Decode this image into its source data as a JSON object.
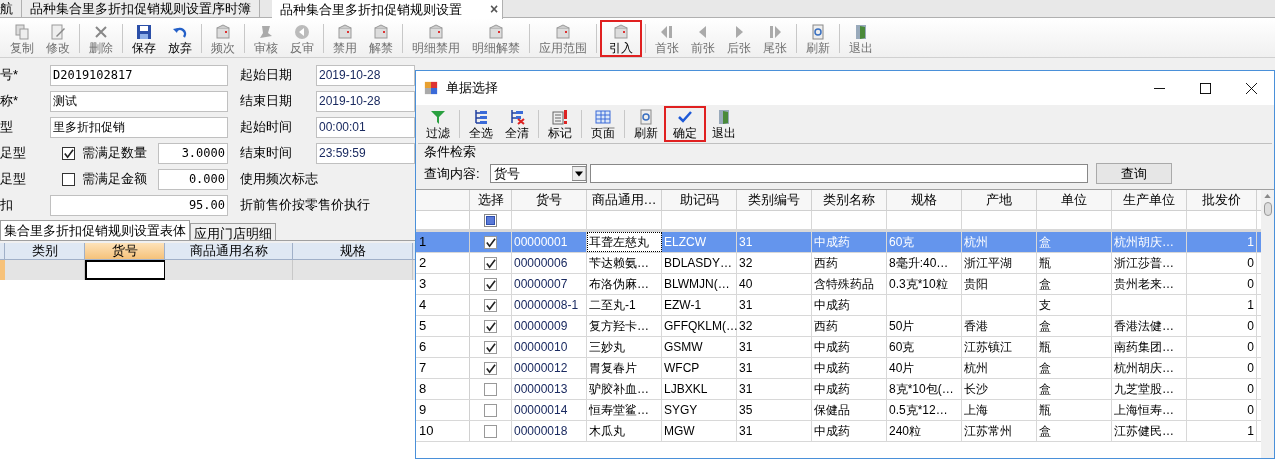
{
  "tabs": [
    {
      "label": "航",
      "selected": false
    },
    {
      "label": "品种集合里多折扣促销规则设置序时簿",
      "selected": false
    },
    {
      "label": "品种集合里多折扣促销规则设置",
      "selected": true,
      "close": "×"
    }
  ],
  "toolbar": [
    [
      {
        "label": "复制",
        "disabled": true,
        "highlighted": false
      },
      {
        "label": "修改",
        "disabled": true,
        "highlighted": false
      }
    ],
    [
      {
        "label": "删除",
        "disabled": true,
        "highlighted": false
      }
    ],
    [
      {
        "label": "保存",
        "disabled": false,
        "highlighted": false
      },
      {
        "label": "放弃",
        "disabled": false,
        "highlighted": false
      }
    ],
    [
      {
        "label": "频次",
        "disabled": true,
        "highlighted": false
      }
    ],
    [
      {
        "label": "审核",
        "disabled": true,
        "highlighted": false
      },
      {
        "label": "反审",
        "disabled": true,
        "highlighted": false
      }
    ],
    [
      {
        "label": "禁用",
        "disabled": true,
        "highlighted": false
      },
      {
        "label": "解禁",
        "disabled": true,
        "highlighted": false
      }
    ],
    [
      {
        "label": "明细禁用",
        "disabled": true,
        "highlighted": false
      },
      {
        "label": "明细解禁",
        "disabled": true,
        "highlighted": false
      }
    ],
    [
      {
        "label": "应用范围",
        "disabled": true,
        "highlighted": false
      }
    ],
    [
      {
        "label": "引入",
        "disabled": false,
        "highlighted": true
      }
    ],
    [
      {
        "label": "首张",
        "disabled": true,
        "highlighted": false
      },
      {
        "label": "前张",
        "disabled": true,
        "highlighted": false
      },
      {
        "label": "后张",
        "disabled": true,
        "highlighted": false
      },
      {
        "label": "尾张",
        "disabled": true,
        "highlighted": false
      }
    ],
    [
      {
        "label": "刷新",
        "disabled": true,
        "highlighted": false
      }
    ],
    [
      {
        "label": "退出",
        "disabled": true,
        "highlighted": false
      }
    ]
  ],
  "form": [
    {
      "left": {
        "kind": "text",
        "label": "号*",
        "value": "D2019102817"
      },
      "right": {
        "label": "起始日期",
        "value": "2019-10-28"
      }
    },
    {
      "left": {
        "kind": "text",
        "label": "称*",
        "value": "测试"
      },
      "right": {
        "label": "结束日期",
        "value": "2019-10-28"
      }
    },
    {
      "left": {
        "kind": "text",
        "label": "型",
        "value": "里多折扣促销"
      },
      "right": {
        "label": "起始时间",
        "value": "00:00:01"
      }
    },
    {
      "left": {
        "kind": "check",
        "label": "足型",
        "checked": true,
        "sub_label": "需满足数量",
        "value": "3.0000"
      },
      "right": {
        "label": "结束时间",
        "value": "23:59:59"
      }
    },
    {
      "left": {
        "kind": "check",
        "label": "足型",
        "checked": false,
        "sub_label": "需满足金额",
        "value": "0.000"
      },
      "right": {
        "label": "使用频次标志"
      }
    },
    {
      "left": {
        "kind": "number",
        "label": "扣",
        "value": "95.00"
      },
      "right": {
        "label": "折前售价按零售价执行"
      }
    }
  ],
  "detail_tabs": [
    {
      "label": "集合里多折扣促销规则设置表体",
      "selected": true
    },
    {
      "label": "应用门店明细",
      "selected": false
    }
  ],
  "detail_grid": {
    "columns": [
      {
        "label": "类别",
        "selected": false
      },
      {
        "label": "货号",
        "selected": true
      },
      {
        "label": "商品通用名称",
        "selected": false
      },
      {
        "label": "规格",
        "selected": false
      }
    ]
  },
  "dialog": {
    "title": "单据选择",
    "toolbar": [
      [
        {
          "label": "过滤",
          "highlighted": false
        }
      ],
      [
        {
          "label": "全选",
          "highlighted": false
        },
        {
          "label": "全清",
          "highlighted": false
        }
      ],
      [
        {
          "label": "标记",
          "highlighted": false
        }
      ],
      [
        {
          "label": "页面",
          "highlighted": false
        }
      ],
      [
        {
          "label": "刷新",
          "highlighted": false
        },
        {
          "label": "确定",
          "highlighted": true
        },
        {
          "label": "退出",
          "highlighted": false
        }
      ]
    ],
    "search": {
      "group": "条件检索",
      "label": "查询内容:",
      "field": "货号",
      "button": "查询"
    },
    "select_column": {
      "label": "选择",
      "indeterminate": true
    },
    "columns": [
      "货号",
      "商品通用…",
      "助记码",
      "类别编号",
      "类别名称",
      "规格",
      "产地",
      "单位",
      "生产单位",
      "批发价"
    ],
    "rows": [
      {
        "n": "1",
        "checked": true,
        "selected": true,
        "cells": [
          "00000001",
          "耳聋左慈丸",
          "ELZCW",
          "31",
          "中成药",
          "60克",
          "杭州",
          "盒",
          "杭州胡庆…",
          "1"
        ]
      },
      {
        "n": "2",
        "checked": true,
        "selected": false,
        "cells": [
          "00000006",
          "苄达赖氨…",
          "BDLASDY…",
          "32",
          "西药",
          "8毫升:40…",
          "浙江平湖",
          "瓶",
          "浙江莎普…",
          "0"
        ]
      },
      {
        "n": "3",
        "checked": true,
        "selected": false,
        "cells": [
          "00000007",
          "布洛伪麻…",
          "BLWMJN(…",
          "40",
          "含特殊药品",
          "0.3克*10粒",
          "贵阳",
          "盒",
          "贵州老来…",
          "0"
        ]
      },
      {
        "n": "4",
        "checked": true,
        "selected": false,
        "cells": [
          "00000008-1",
          "二至丸-1",
          "EZW-1",
          "31",
          "中成药",
          "",
          "",
          "支",
          "",
          "1"
        ]
      },
      {
        "n": "5",
        "checked": true,
        "selected": false,
        "cells": [
          "00000009",
          "复方羟卡…",
          "GFFQKLM(…",
          "32",
          "西药",
          "50片",
          "香港",
          "盒",
          "香港法健…",
          "0"
        ]
      },
      {
        "n": "6",
        "checked": true,
        "selected": false,
        "cells": [
          "00000010",
          "三妙丸",
          "GSMW",
          "31",
          "中成药",
          "60克",
          "江苏镇江",
          "瓶",
          "南药集团…",
          "0"
        ]
      },
      {
        "n": "7",
        "checked": true,
        "selected": false,
        "cells": [
          "00000012",
          "胃复春片",
          "WFCP",
          "31",
          "中成药",
          "40片",
          "杭州",
          "盒",
          "杭州胡庆…",
          "0"
        ]
      },
      {
        "n": "8",
        "checked": false,
        "selected": false,
        "cells": [
          "00000013",
          "驴胶补血…",
          "LJBXKL",
          "31",
          "中成药",
          "8克*10包(…",
          "长沙",
          "盒",
          "九芝堂股…",
          "0"
        ]
      },
      {
        "n": "9",
        "checked": false,
        "selected": false,
        "cells": [
          "00000014",
          "恒寿堂鲨…",
          "SYGY",
          "35",
          "保健品",
          "0.5克*12…",
          "上海",
          "瓶",
          "上海恒寿…",
          "0"
        ]
      },
      {
        "n": "10",
        "checked": false,
        "selected": false,
        "cells": [
          "00000018",
          "木瓜丸",
          "MGW",
          "31",
          "中成药",
          "240粒",
          "江苏常州",
          "盒",
          "江苏健民…",
          "1"
        ]
      }
    ]
  }
}
